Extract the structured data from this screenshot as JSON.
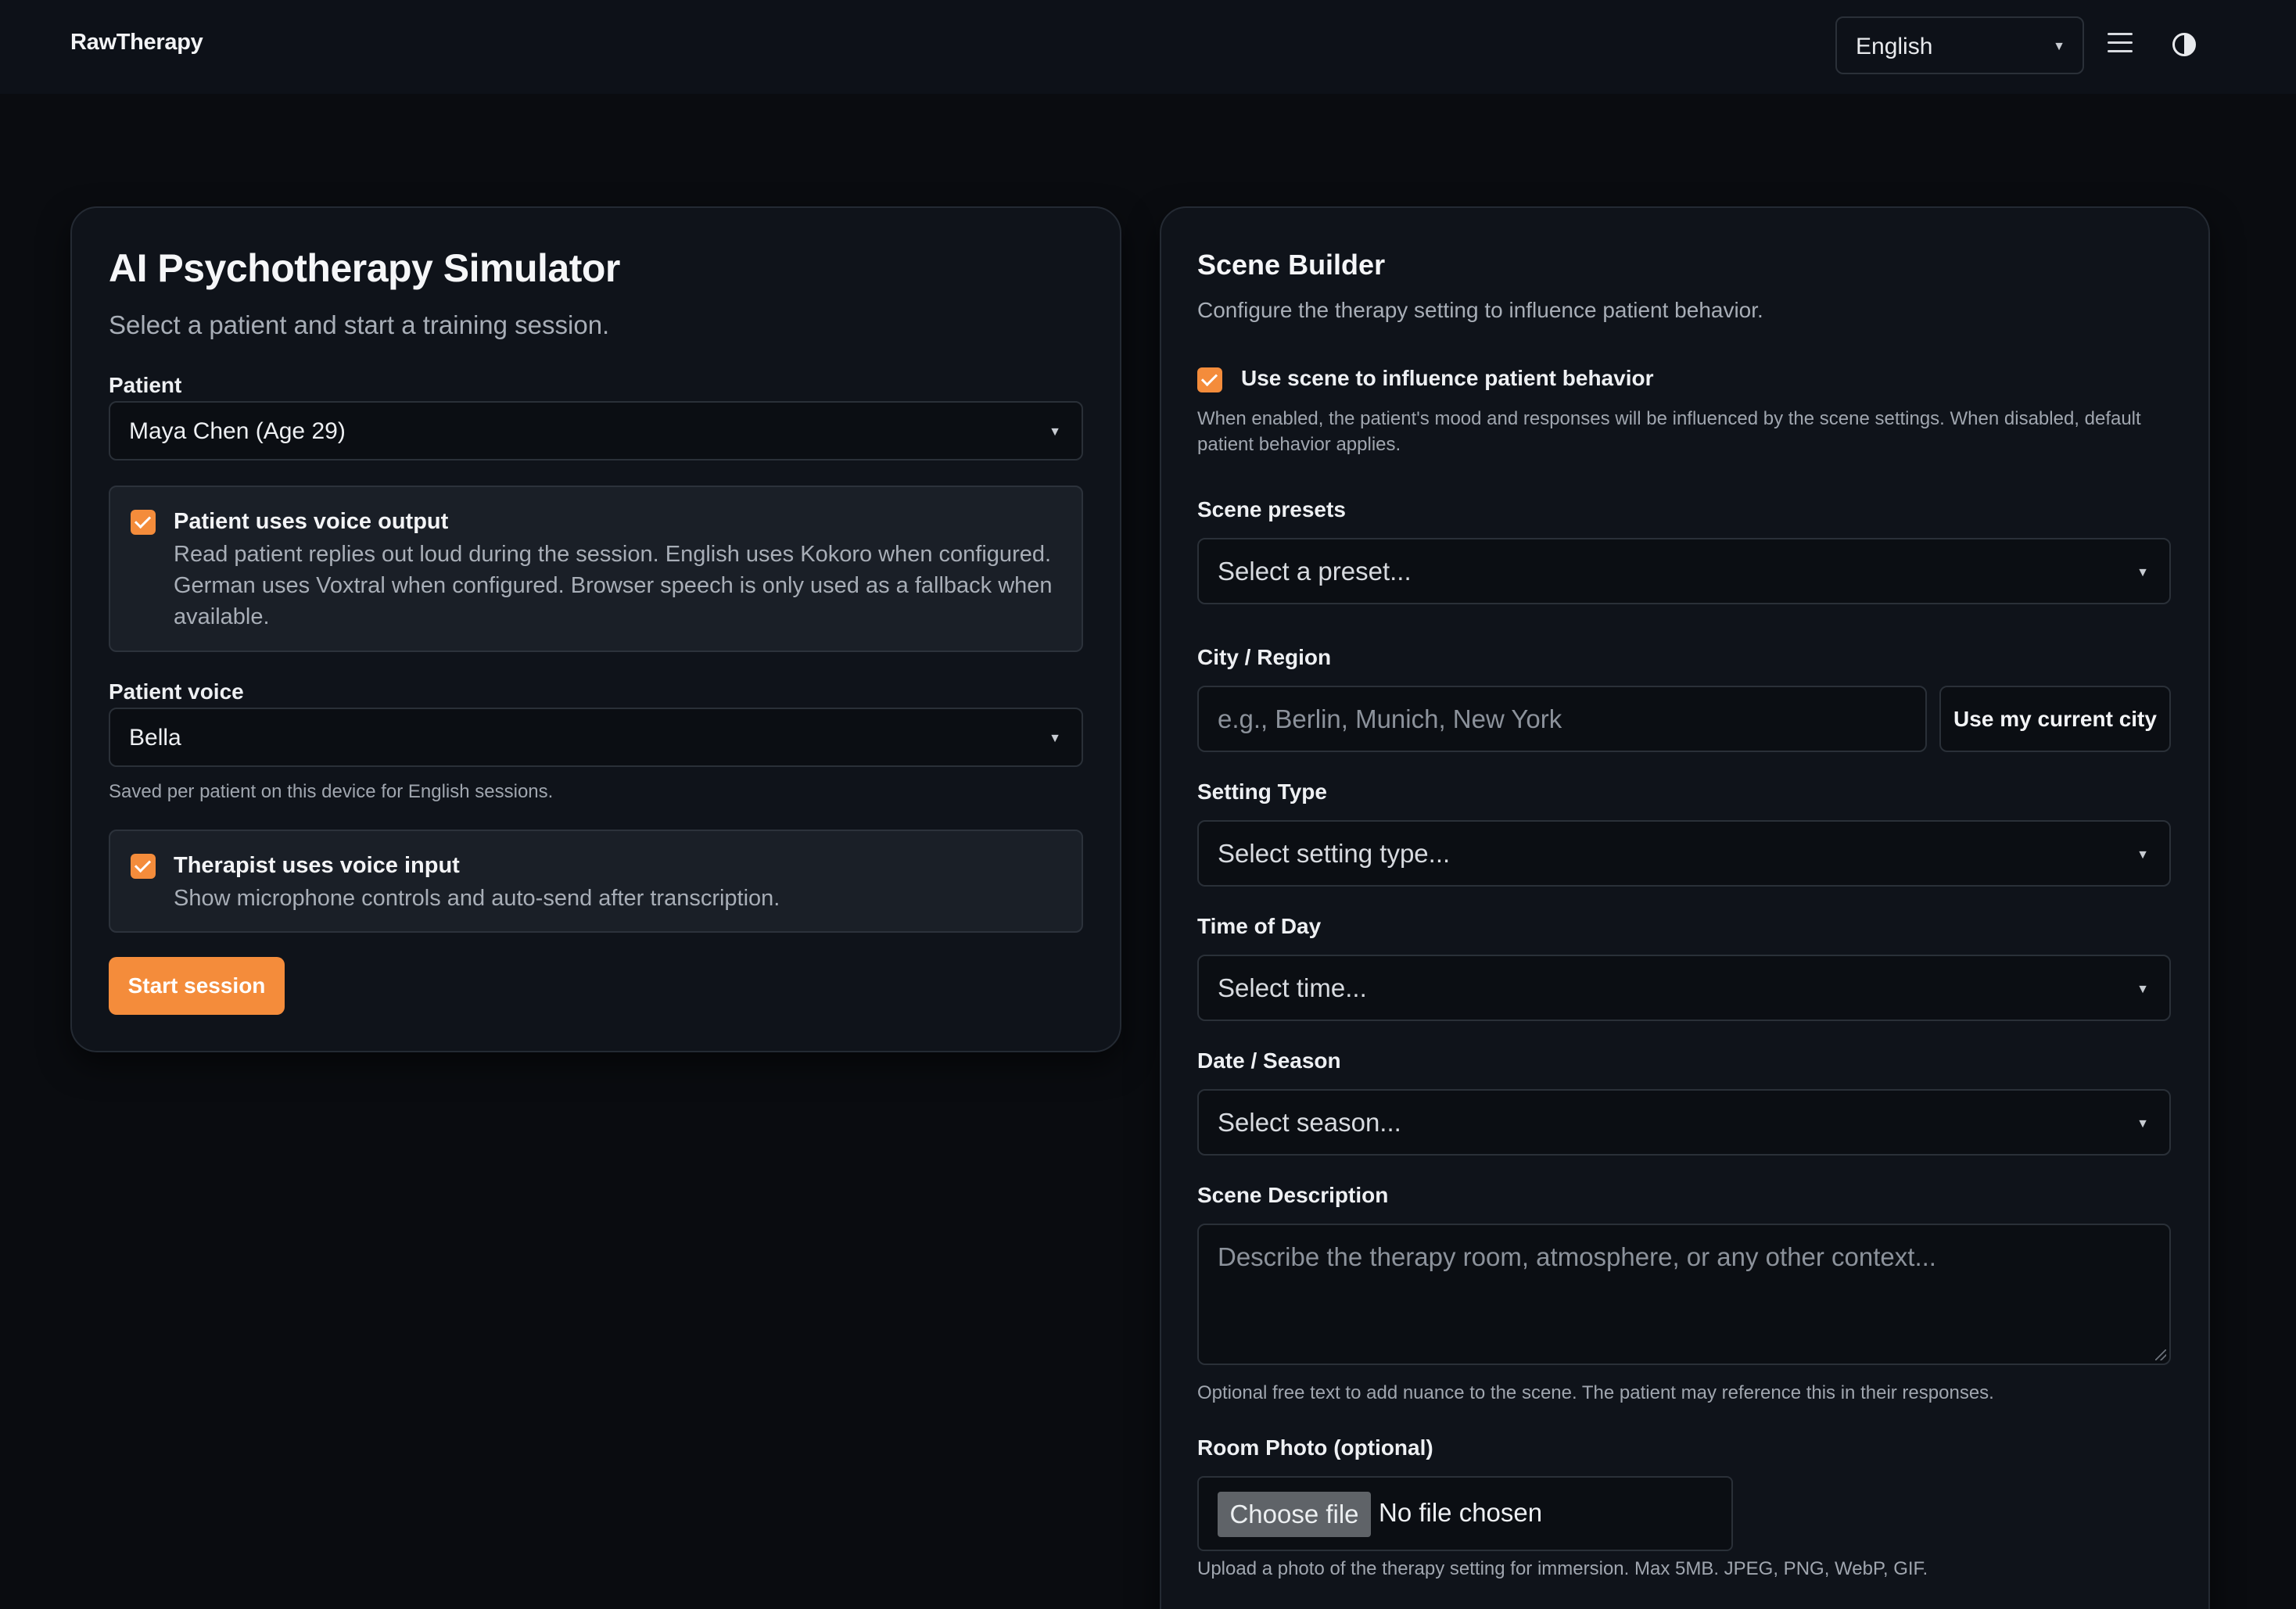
{
  "header": {
    "brand": "RawTherapy",
    "language": "English",
    "menu_icon": "hamburger-menu-icon",
    "theme_icon": "contrast-toggle-icon"
  },
  "session_card": {
    "title": "AI Psychotherapy Simulator",
    "subtitle": "Select a patient and start a training session.",
    "patient_label": "Patient",
    "patient_value": "Maya Chen (Age 29)",
    "voice_output": {
      "checked": true,
      "title": "Patient uses voice output",
      "description": "Read patient replies out loud during the session. English uses Kokoro when configured. German uses Voxtral when configured. Browser speech is only used as a fallback when available."
    },
    "patient_voice_label": "Patient voice",
    "patient_voice_value": "Bella",
    "patient_voice_hint": "Saved per patient on this device for English sessions.",
    "voice_input": {
      "checked": true,
      "title": "Therapist uses voice input",
      "description": "Show microphone controls and auto-send after transcription."
    },
    "start_button": "Start session"
  },
  "scene_builder": {
    "title": "Scene Builder",
    "subtitle": "Configure the therapy setting to influence patient behavior.",
    "use_scene": {
      "checked": true,
      "label": "Use scene to influence patient behavior",
      "hint": "When enabled, the patient's mood and responses will be influenced by the scene settings. When disabled, default patient behavior applies."
    },
    "presets_label": "Scene presets",
    "presets_placeholder": "Select a preset...",
    "city_label": "City / Region",
    "city_placeholder": "e.g., Berlin, Munich, New York",
    "use_city_button": "Use my current city",
    "setting_label": "Setting Type",
    "setting_placeholder": "Select setting type...",
    "time_label": "Time of Day",
    "time_placeholder": "Select time...",
    "season_label": "Date / Season",
    "season_placeholder": "Select season...",
    "description_label": "Scene Description",
    "description_placeholder": "Describe the therapy room, atmosphere, or any other context...",
    "description_hint": "Optional free text to add nuance to the scene. The patient may reference this in their responses.",
    "photo_label": "Room Photo (optional)",
    "file_button": "Choose file",
    "file_status": "No file chosen",
    "photo_hint": "Upload a photo of the therapy setting for immersion. Max 5MB. JPEG, PNG, WebP, GIF."
  },
  "colors": {
    "accent": "#f48c3b",
    "background": "#0a0c10",
    "card": "#0f131a"
  }
}
